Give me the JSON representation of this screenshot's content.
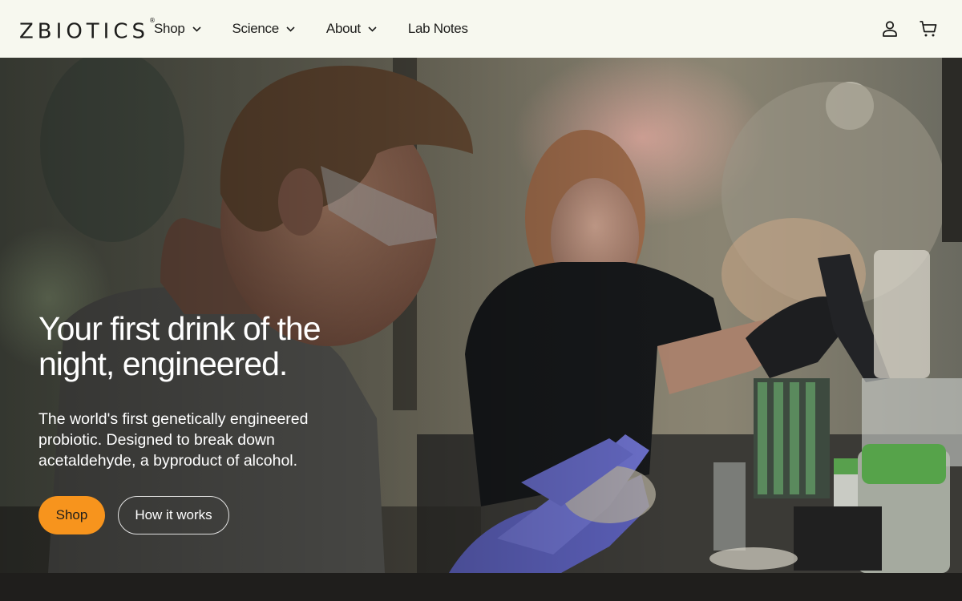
{
  "header": {
    "logo": "ZBIOTICS",
    "logo_mark": "®",
    "nav": [
      {
        "label": "Shop",
        "has_dropdown": true
      },
      {
        "label": "Science",
        "has_dropdown": true
      },
      {
        "label": "About",
        "has_dropdown": true
      },
      {
        "label": "Lab Notes",
        "has_dropdown": false
      }
    ],
    "icons": [
      "account-icon",
      "cart-icon"
    ]
  },
  "hero": {
    "title": "Your first drink of the night, engineered.",
    "subtitle": "The world's first genetically engineered probiotic. Designed to break down acetaldehyde, a byproduct of alcohol.",
    "primary_button": "Shop",
    "secondary_button": "How it works",
    "image": "lab-scientists-photo"
  },
  "colors": {
    "header_bg": "#f7f8ef",
    "accent": "#f7941d",
    "text_dark": "#1d1d1b",
    "footer_bg": "#1f1e1c"
  }
}
